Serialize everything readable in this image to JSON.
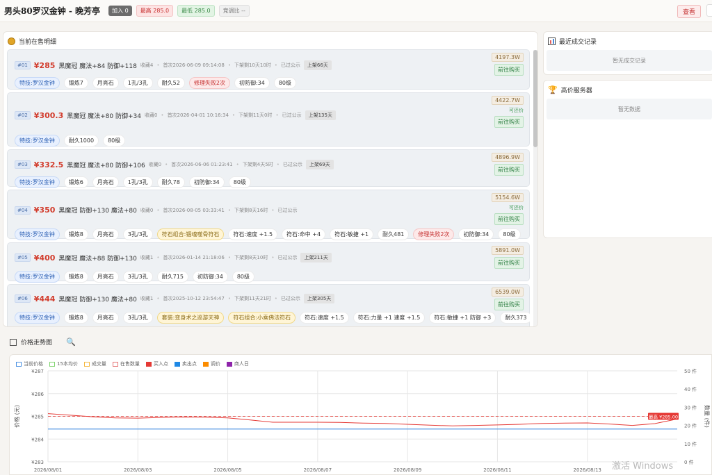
{
  "header": {
    "title": "男头80罗汉金钟 - 晚芳亭",
    "badges": [
      "加入 0",
      "最高 285.0",
      "最低 285.0",
      "竞调比 --"
    ],
    "view_button": "查看"
  },
  "listings": {
    "title": "当前在售明细",
    "items": [
      {
        "num": "#01",
        "price": "¥285",
        "name": "黑魔冠  魔法+84 防御+118",
        "fav": "收藏4",
        "first": "首次2026-06-09 09:14:08",
        "remain": "下架剩10天10时",
        "status": "已过公示",
        "shelf": "上架66天",
        "wprice": "4197.3W",
        "bargain": "",
        "buy": "前往购买",
        "tags": [
          {
            "t": "特技:罗汉金钟",
            "c": "blue"
          },
          {
            "t": "锻炼7",
            "c": ""
          },
          {
            "t": "月亮石",
            "c": ""
          },
          {
            "t": "1孔/3孔",
            "c": ""
          },
          {
            "t": "耐久52",
            "c": ""
          },
          {
            "t": "修理失败2次",
            "c": "red"
          },
          {
            "t": "初防御:34",
            "c": ""
          },
          {
            "t": "80级",
            "c": ""
          }
        ]
      },
      {
        "num": "#02",
        "price": "¥300.3",
        "name": "黑魔冠  魔法+80 防御+34",
        "fav": "收藏0",
        "first": "首次2026-04-01 10:16:34",
        "remain": "下架剩11天0时",
        "status": "已过公示",
        "shelf": "上架135天",
        "wprice": "4422.7W",
        "bargain": "可还价",
        "buy": "前往购买",
        "tags": [
          {
            "t": "特技:罗汉金钟",
            "c": "blue"
          },
          {
            "t": "耐久1000",
            "c": ""
          },
          {
            "t": "80级",
            "c": ""
          }
        ]
      },
      {
        "num": "#03",
        "price": "¥332.5",
        "name": "黑魔冠  魔法+80 防御+106",
        "fav": "收藏0",
        "first": "首次2026-06-06 01:23:41",
        "remain": "下架剩4天5时",
        "status": "已过公示",
        "shelf": "上架69天",
        "wprice": "4896.9W",
        "bargain": "",
        "buy": "前往购买",
        "tags": [
          {
            "t": "特技:罗汉金钟",
            "c": "blue"
          },
          {
            "t": "锻炼6",
            "c": ""
          },
          {
            "t": "月亮石",
            "c": ""
          },
          {
            "t": "1孔/3孔",
            "c": ""
          },
          {
            "t": "耐久78",
            "c": ""
          },
          {
            "t": "初防御:34",
            "c": ""
          },
          {
            "t": "80级",
            "c": ""
          }
        ]
      },
      {
        "num": "#04",
        "price": "¥350",
        "name": "黑魔冠  防御+130 魔法+80",
        "fav": "收藏0",
        "first": "首次2026-08-05 03:33:41",
        "remain": "下架剩8天16时",
        "status": "已过公示",
        "shelf": "",
        "wprice": "5154.6W",
        "bargain": "可还价",
        "buy": "前往购买",
        "tags": [
          {
            "t": "特技:罗汉金钟",
            "c": "blue"
          },
          {
            "t": "锻炼8",
            "c": ""
          },
          {
            "t": "月亮石",
            "c": ""
          },
          {
            "t": "3孔/3孔",
            "c": ""
          },
          {
            "t": "符石组合:锢魂噬骨符石",
            "c": "yellow"
          },
          {
            "t": "符石:速度 +1.5",
            "c": ""
          },
          {
            "t": "符石:命中 +4",
            "c": ""
          },
          {
            "t": "符石:敏捷 +1",
            "c": ""
          },
          {
            "t": "耐久481",
            "c": ""
          },
          {
            "t": "修理失败2次",
            "c": "red"
          },
          {
            "t": "初防御:34",
            "c": ""
          },
          {
            "t": "80级",
            "c": ""
          }
        ]
      },
      {
        "num": "#05",
        "price": "¥400",
        "name": "黑魔冠  魔法+88 防御+130",
        "fav": "收藏1",
        "first": "首次2026-01-14 21:18:06",
        "remain": "下架剩8天10时",
        "status": "已过公示",
        "shelf": "上架211天",
        "wprice": "5891.0W",
        "bargain": "",
        "buy": "前往购买",
        "tags": [
          {
            "t": "特技:罗汉金钟",
            "c": "blue"
          },
          {
            "t": "锻炼8",
            "c": ""
          },
          {
            "t": "月亮石",
            "c": ""
          },
          {
            "t": "3孔/3孔",
            "c": ""
          },
          {
            "t": "耐久715",
            "c": ""
          },
          {
            "t": "初防御:34",
            "c": ""
          },
          {
            "t": "80级",
            "c": ""
          }
        ]
      },
      {
        "num": "#06",
        "price": "¥444",
        "name": "黑魔冠  防御+130 魔法+80",
        "fav": "收藏1",
        "first": "首次2025-10-12 23:54:47",
        "remain": "下架剩11天21时",
        "status": "已过公示",
        "shelf": "上架305天",
        "wprice": "6539.0W",
        "bargain": "",
        "buy": "前往购买",
        "tags": [
          {
            "t": "特技:罗汉金钟",
            "c": "blue"
          },
          {
            "t": "锻炼8",
            "c": ""
          },
          {
            "t": "月亮石",
            "c": ""
          },
          {
            "t": "3孔/3孔",
            "c": ""
          },
          {
            "t": "套装:变身术之巡游天神",
            "c": "yellow"
          },
          {
            "t": "符石组合:小乘佛法符石",
            "c": "yellow"
          },
          {
            "t": "符石:速度 +1.5",
            "c": ""
          },
          {
            "t": "符石:力量 +1 速度 +1.5",
            "c": ""
          },
          {
            "t": "符石:敏捷 +1 防御 +3",
            "c": ""
          },
          {
            "t": "耐久373",
            "c": ""
          }
        ]
      }
    ]
  },
  "recent_deals": {
    "title": "最近成交记录",
    "empty": "暂无成交记录"
  },
  "high_price_servers": {
    "title": "高价服务器",
    "empty": "暂无数据"
  },
  "chart_section": {
    "title": "价格走势图"
  },
  "chart_data": {
    "type": "line",
    "legend": [
      "当前价格",
      "15本均价",
      "成交量",
      "在售数量",
      "买入点",
      "卖出点",
      "调价",
      "商人日"
    ],
    "legend_colors": [
      "#4a90e2",
      "#7ed36d",
      "#f5b942",
      "#e57373",
      "#e53935",
      "#1e88e5",
      "#fb8c00",
      "#8e24aa"
    ],
    "x_ticks": [
      "2026/08/01",
      "2026/08/03",
      "2026/08/05",
      "2026/08/07",
      "2026/08/09",
      "2026/08/11",
      "2026/08/13"
    ],
    "yleft_ticks": [
      "¥287",
      "¥286",
      "¥285",
      "¥284",
      "¥283"
    ],
    "yright_ticks": [
      "50 件",
      "40 件",
      "30 件",
      "20 件",
      "10 件",
      "0 件"
    ],
    "ylabel_left": "价格 (元)",
    "ylabel_right": "数量 (件)",
    "ylim_left": [
      283,
      287
    ],
    "ylim_right": [
      0,
      50
    ],
    "max_label": "最高 ¥285.00",
    "max_value": 285.0,
    "x": [
      0,
      0.5,
      1,
      1.5,
      2,
      2.5,
      3,
      3.5,
      4,
      4.5,
      5,
      5.5,
      6,
      6.5,
      7,
      7.5,
      8,
      8.5,
      9,
      9.5,
      10,
      10.5,
      11,
      11.5,
      12,
      12.5,
      13,
      13.5,
      14
    ],
    "price_series": [
      285.12,
      285.05,
      284.98,
      284.93,
      284.92,
      284.95,
      284.97,
      284.96,
      284.93,
      284.84,
      284.74,
      284.74,
      284.74,
      284.73,
      284.7,
      284.69,
      284.65,
      284.61,
      284.58,
      284.6,
      284.62,
      284.65,
      284.69,
      284.7,
      284.71,
      284.66,
      284.6,
      284.68,
      284.88
    ],
    "count_series": [
      18,
      18,
      18,
      18,
      18,
      18,
      18,
      18,
      18,
      18,
      18,
      18,
      18,
      18,
      18,
      18,
      18,
      18,
      18,
      18,
      18,
      18,
      18,
      18,
      18,
      18,
      18,
      18,
      18
    ],
    "colors": {
      "price": "#e53935",
      "count": "#4a90e2",
      "max_line": "#e53935"
    }
  },
  "watermark": "激活 Windows"
}
